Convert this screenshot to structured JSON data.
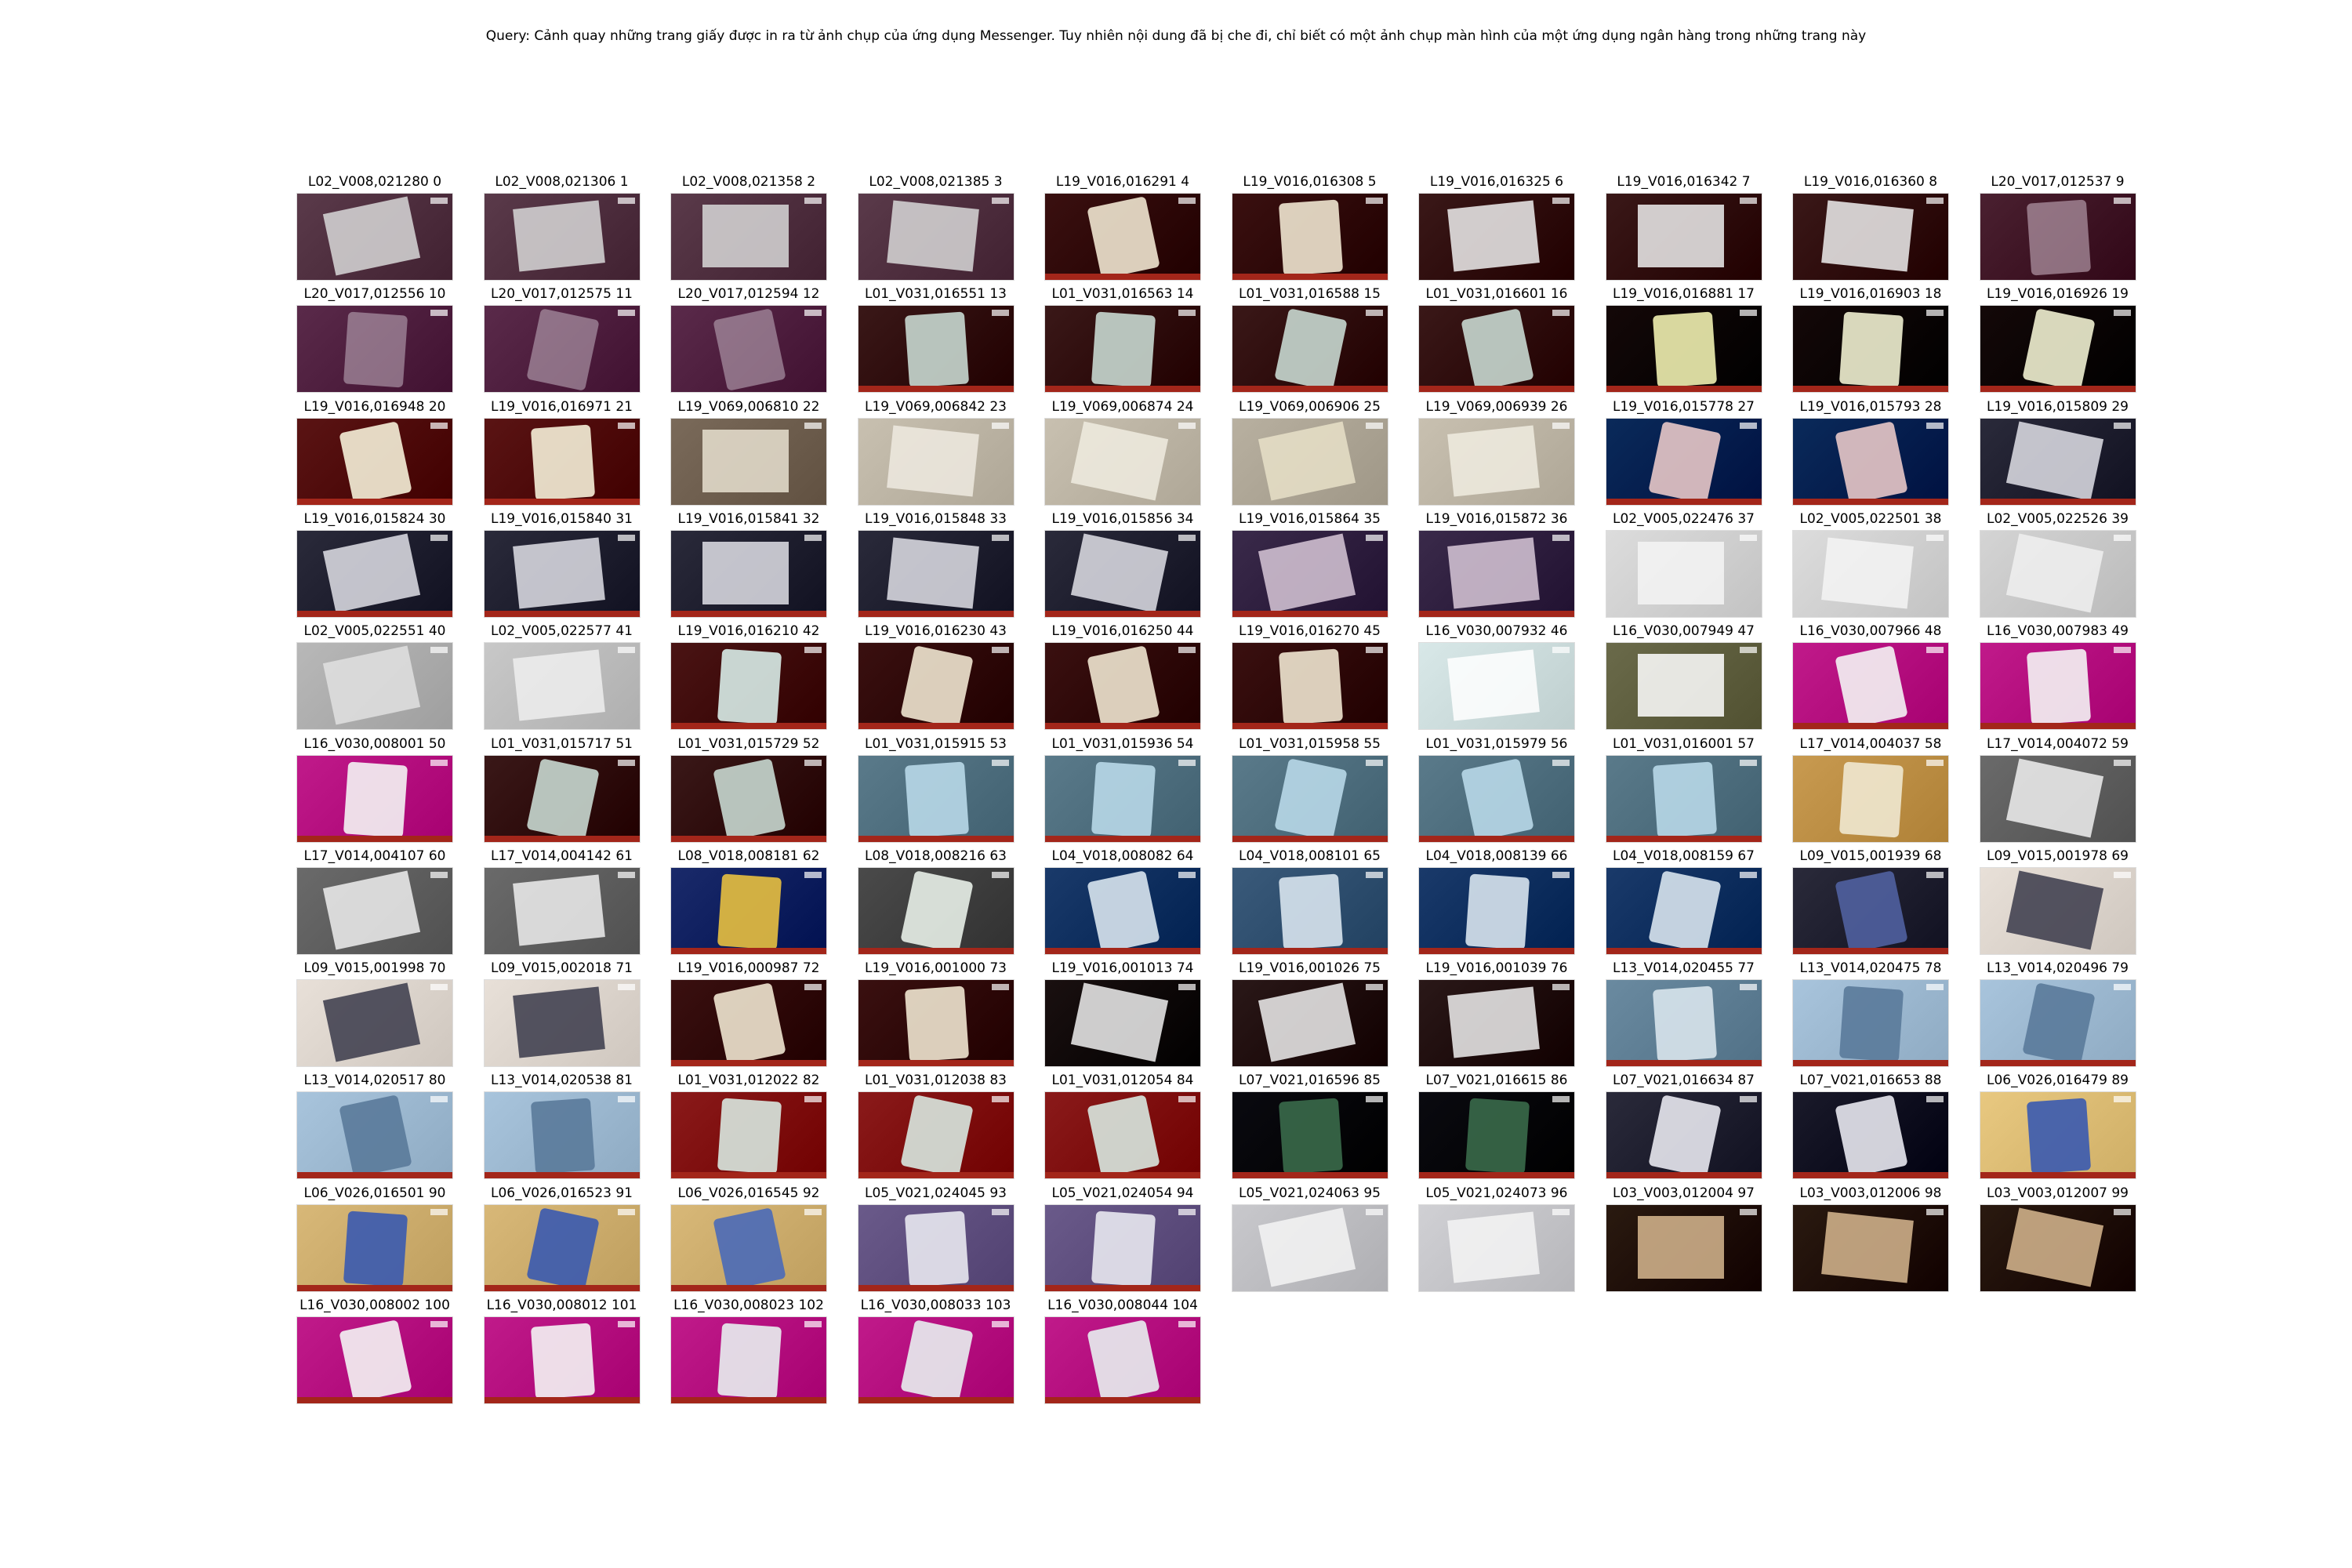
{
  "query": "Query: Cảnh quay những trang giấy được in ra từ ảnh chụp của ứng dụng Messenger. Tuy nhiên nội dung đã bị che đi, chỉ biết có một ảnh chụp màn hình của một ứng dụng ngân hàng trong những trang này",
  "frames": [
    {
      "label": "L02_V008,021280 0",
      "scene": "paper",
      "bg": "#5a3a4a",
      "accent": "#d8d8d8"
    },
    {
      "label": "L02_V008,021306 1",
      "scene": "paper",
      "bg": "#5a3a4a",
      "accent": "#d8d8d8"
    },
    {
      "label": "L02_V008,021358 2",
      "scene": "paper",
      "bg": "#5a3a4a",
      "accent": "#d8d8d8"
    },
    {
      "label": "L02_V008,021385 3",
      "scene": "paper",
      "bg": "#5a3a4a",
      "accent": "#d8d8d8"
    },
    {
      "label": "L19_V016,016291 4",
      "scene": "phone-red",
      "bg": "#3a1010",
      "accent": "#f0e6d0"
    },
    {
      "label": "L19_V016,016308 5",
      "scene": "phone-red",
      "bg": "#3a1010",
      "accent": "#f0e6d0"
    },
    {
      "label": "L19_V016,016325 6",
      "scene": "paper",
      "bg": "#3a1818",
      "accent": "#eeeeee"
    },
    {
      "label": "L19_V016,016342 7",
      "scene": "paper",
      "bg": "#3a1818",
      "accent": "#eeeeee"
    },
    {
      "label": "L19_V016,016360 8",
      "scene": "paper",
      "bg": "#3a1818",
      "accent": "#eeeeee"
    },
    {
      "label": "L20_V017,012537 9",
      "scene": "blur",
      "bg": "#4a2030",
      "accent": "#c8b0c0"
    },
    {
      "label": "L20_V017,012556 10",
      "scene": "blur",
      "bg": "#5a2a4a",
      "accent": "#bba8b8"
    },
    {
      "label": "L20_V017,012575 11",
      "scene": "blur",
      "bg": "#5a2a4a",
      "accent": "#bba8b8"
    },
    {
      "label": "L20_V017,012594 12",
      "scene": "blur",
      "bg": "#5a2a4a",
      "accent": "#bba8b8"
    },
    {
      "label": "L01_V031,016551 13",
      "scene": "phone-red",
      "bg": "#3a1818",
      "accent": "#c8d8d0"
    },
    {
      "label": "L01_V031,016563 14",
      "scene": "phone-red",
      "bg": "#3a1818",
      "accent": "#c8d8d0"
    },
    {
      "label": "L01_V031,016588 15",
      "scene": "phone-red",
      "bg": "#3a1818",
      "accent": "#c8d8d0"
    },
    {
      "label": "L01_V031,016601 16",
      "scene": "phone-red",
      "bg": "#3a1818",
      "accent": "#c8d8d0"
    },
    {
      "label": "L19_V016,016881 17",
      "scene": "phone-dark",
      "bg": "#140808",
      "accent": "#f0f0b0"
    },
    {
      "label": "L19_V016,016903 18",
      "scene": "phone-dark",
      "bg": "#140808",
      "accent": "#f0f0d0"
    },
    {
      "label": "L19_V016,016926 19",
      "scene": "phone-dark",
      "bg": "#140808",
      "accent": "#f0f0d0"
    },
    {
      "label": "L19_V016,016948 20",
      "scene": "phone-dark",
      "bg": "#5a1414",
      "accent": "#f5f0d8"
    },
    {
      "label": "L19_V016,016971 21",
      "scene": "phone-dark",
      "bg": "#5a1414",
      "accent": "#f5f0d8"
    },
    {
      "label": "L19_V069,006810 22",
      "scene": "hand",
      "bg": "#7a6a5a",
      "accent": "#e8e0d0"
    },
    {
      "label": "L19_V069,006842 23",
      "scene": "hand",
      "bg": "#c8c0b0",
      "accent": "#eeeae0"
    },
    {
      "label": "L19_V069,006874 24",
      "scene": "hand",
      "bg": "#c8c0b0",
      "accent": "#f0ece0"
    },
    {
      "label": "L19_V069,006906 25",
      "scene": "hand",
      "bg": "#b8b0a0",
      "accent": "#e8e0c8"
    },
    {
      "label": "L19_V069,006939 26",
      "scene": "hand",
      "bg": "#c8c0b0",
      "accent": "#f0ece0"
    },
    {
      "label": "L19_V016,015778 27",
      "scene": "studio",
      "bg": "#0a2a5a",
      "accent": "#e8c8c8"
    },
    {
      "label": "L19_V016,015793 28",
      "scene": "studio",
      "bg": "#0a2a5a",
      "accent": "#e8c8c8"
    },
    {
      "label": "L19_V016,015809 29",
      "scene": "text",
      "bg": "#2a2a3a",
      "accent": "#e0e0e8"
    },
    {
      "label": "L19_V016,015824 30",
      "scene": "text",
      "bg": "#2a2a3a",
      "accent": "#e0e0e8"
    },
    {
      "label": "L19_V016,015840 31",
      "scene": "text",
      "bg": "#2a2a3a",
      "accent": "#e0e0e8"
    },
    {
      "label": "L19_V016,015841 32",
      "scene": "text",
      "bg": "#2a2a3a",
      "accent": "#e0e0e8"
    },
    {
      "label": "L19_V016,015848 33",
      "scene": "text",
      "bg": "#2a2a3a",
      "accent": "#e0e0e8"
    },
    {
      "label": "L19_V016,015856 34",
      "scene": "text",
      "bg": "#2a2a3a",
      "accent": "#e0e0e8"
    },
    {
      "label": "L19_V016,015864 35",
      "scene": "news",
      "bg": "#3a2a4a",
      "accent": "#d8c8d8"
    },
    {
      "label": "L19_V016,015872 36",
      "scene": "news",
      "bg": "#3a2a4a",
      "accent": "#d8c8d8"
    },
    {
      "label": "L02_V005,022476 37",
      "scene": "doc",
      "bg": "#dcdcdc",
      "accent": "#f4f4f4"
    },
    {
      "label": "L02_V005,022501 38",
      "scene": "doc",
      "bg": "#dcdcdc",
      "accent": "#f4f4f4"
    },
    {
      "label": "L02_V005,022526 39",
      "scene": "doc",
      "bg": "#d4d4d4",
      "accent": "#f0f0f0"
    },
    {
      "label": "L02_V005,022551 40",
      "scene": "doc",
      "bg": "#b8b8b8",
      "accent": "#e0e0e0"
    },
    {
      "label": "L02_V005,022577 41",
      "scene": "doc",
      "bg": "#c8c8c8",
      "accent": "#eeeeee"
    },
    {
      "label": "L19_V016,016210 42",
      "scene": "phone-red",
      "bg": "#4a1414",
      "accent": "#d8ece8"
    },
    {
      "label": "L19_V016,016230 43",
      "scene": "phone-red",
      "bg": "#3a1010",
      "accent": "#f0e6d0"
    },
    {
      "label": "L19_V016,016250 44",
      "scene": "phone-red",
      "bg": "#3a1010",
      "accent": "#f0e6d0"
    },
    {
      "label": "L19_V016,016270 45",
      "scene": "phone-red",
      "bg": "#3a1010",
      "accent": "#f0e6d0"
    },
    {
      "label": "L16_V030,007932 46",
      "scene": "doc",
      "bg": "#d8e8e8",
      "accent": "#ffffff"
    },
    {
      "label": "L16_V030,007949 47",
      "scene": "doc",
      "bg": "#6a6a4a",
      "accent": "#ffffff"
    },
    {
      "label": "L16_V030,007966 48",
      "scene": "magenta",
      "bg": "#c01a8a",
      "accent": "#f4f4f4"
    },
    {
      "label": "L16_V030,007983 49",
      "scene": "magenta",
      "bg": "#c01a8a",
      "accent": "#f4f4f4"
    },
    {
      "label": "L16_V030,008001 50",
      "scene": "magenta",
      "bg": "#c01a8a",
      "accent": "#f4f4f4"
    },
    {
      "label": "L01_V031,015717 51",
      "scene": "phone-red",
      "bg": "#3a1818",
      "accent": "#c8d8d0"
    },
    {
      "label": "L01_V031,015729 52",
      "scene": "phone-red",
      "bg": "#3a1818",
      "accent": "#c8d8d0"
    },
    {
      "label": "L01_V031,015915 53",
      "scene": "blurblue",
      "bg": "#5a7a8a",
      "accent": "#b8d8e8"
    },
    {
      "label": "L01_V031,015936 54",
      "scene": "blurblue",
      "bg": "#5a7a8a",
      "accent": "#b8d8e8"
    },
    {
      "label": "L01_V031,015958 55",
      "scene": "blurblue",
      "bg": "#5a7a8a",
      "accent": "#b8d8e8"
    },
    {
      "label": "L01_V031,015979 56",
      "scene": "blurblue",
      "bg": "#5a7a8a",
      "accent": "#b8d8e8"
    },
    {
      "label": "L01_V031,016001 57",
      "scene": "blurblue",
      "bg": "#5a7a8a",
      "accent": "#b8d8e8"
    },
    {
      "label": "L17_V014,004037 58",
      "scene": "room",
      "bg": "#c89a50",
      "accent": "#f0e8d0"
    },
    {
      "label": "L17_V014,004072 59",
      "scene": "screen",
      "bg": "#6a6a6a",
      "accent": "#f0f0f0"
    },
    {
      "label": "L17_V014,004107 60",
      "scene": "screen",
      "bg": "#6a6a6a",
      "accent": "#eeeeee"
    },
    {
      "label": "L17_V014,004142 61",
      "scene": "screen",
      "bg": "#6a6a6a",
      "accent": "#eeeeee"
    },
    {
      "label": "L08_V018,008181 62",
      "scene": "ad",
      "bg": "#1a2a6a",
      "accent": "#e8c040"
    },
    {
      "label": "L08_V018,008216 63",
      "scene": "phone-dark",
      "bg": "#4a4a4a",
      "accent": "#e8f0e8"
    },
    {
      "label": "L04_V018,008082 64",
      "scene": "bluephone",
      "bg": "#1a3a6a",
      "accent": "#d8e4ee"
    },
    {
      "label": "L04_V018,008101 65",
      "scene": "bluephone",
      "bg": "#3a5a7a",
      "accent": "#d8e4ee"
    },
    {
      "label": "L04_V018,008139 66",
      "scene": "bluephone",
      "bg": "#1a3a6a",
      "accent": "#d8e4ee"
    },
    {
      "label": "L04_V018,008159 67",
      "scene": "bluephone",
      "bg": "#1a3a6a",
      "accent": "#d8e4ee"
    },
    {
      "label": "L09_V015,001939 68",
      "scene": "phone-dark",
      "bg": "#2a2a3a",
      "accent": "#5060a0"
    },
    {
      "label": "L09_V015,001978 69",
      "scene": "hand",
      "bg": "#e8e0d8",
      "accent": "#3a3a4a"
    },
    {
      "label": "L09_V015,001998 70",
      "scene": "hand",
      "bg": "#e8e0d8",
      "accent": "#3a3a4a"
    },
    {
      "label": "L09_V015,002018 71",
      "scene": "hand",
      "bg": "#e8e0d8",
      "accent": "#3a3a4a"
    },
    {
      "label": "L19_V016,000987 72",
      "scene": "phone-red",
      "bg": "#3a1010",
      "accent": "#f0e6d0"
    },
    {
      "label": "L19_V016,001000 73",
      "scene": "phone-red",
      "bg": "#3a1010",
      "accent": "#f0e6d0"
    },
    {
      "label": "L19_V016,001013 74",
      "scene": "paper",
      "bg": "#1a1010",
      "accent": "#f0f0f0"
    },
    {
      "label": "L19_V016,001026 75",
      "scene": "paper",
      "bg": "#2a1818",
      "accent": "#f0f0f0"
    },
    {
      "label": "L19_V016,001039 76",
      "scene": "paper",
      "bg": "#2a1818",
      "accent": "#f0f0f0"
    },
    {
      "label": "L13_V014,020455 77",
      "scene": "desk",
      "bg": "#6a8aa0",
      "accent": "#d8e4ec"
    },
    {
      "label": "L13_V014,020475 78",
      "scene": "desk",
      "bg": "#a8c4dc",
      "accent": "#5a7a9a"
    },
    {
      "label": "L13_V014,020496 79",
      "scene": "desk",
      "bg": "#a8c4dc",
      "accent": "#5a7a9a"
    },
    {
      "label": "L13_V014,020517 80",
      "scene": "desk",
      "bg": "#a8c4dc",
      "accent": "#5a7a9a"
    },
    {
      "label": "L13_V014,020538 81",
      "scene": "desk",
      "bg": "#a8c4dc",
      "accent": "#5a7a9a"
    },
    {
      "label": "L01_V031,012022 82",
      "scene": "phone-red",
      "bg": "#8a1a1a",
      "accent": "#d8e8e0"
    },
    {
      "label": "L01_V031,012038 83",
      "scene": "phone-red",
      "bg": "#8a1a1a",
      "accent": "#d8e8e0"
    },
    {
      "label": "L01_V031,012054 84",
      "scene": "phone-red",
      "bg": "#8a1a1a",
      "accent": "#d8e8e0"
    },
    {
      "label": "L07_V021,016596 85",
      "scene": "phone-dark",
      "bg": "#0a0a10",
      "accent": "#3a6a4a"
    },
    {
      "label": "L07_V021,016615 86",
      "scene": "phone-dark",
      "bg": "#0a0a10",
      "accent": "#3a6a4a"
    },
    {
      "label": "L07_V021,016634 87",
      "scene": "fb",
      "bg": "#2a2a3a",
      "accent": "#e8e8f0"
    },
    {
      "label": "L07_V021,016653 88",
      "scene": "fb",
      "bg": "#1a1a2a",
      "accent": "#e8e8f0"
    },
    {
      "label": "L06_V026,016479 89",
      "scene": "bluephone",
      "bg": "#e8c880",
      "accent": "#3a5ab0"
    },
    {
      "label": "L06_V026,016501 90",
      "scene": "bluephone",
      "bg": "#d8b878",
      "accent": "#3a5ab0"
    },
    {
      "label": "L06_V026,016523 91",
      "scene": "bluephone",
      "bg": "#d8b878",
      "accent": "#3a5ab0"
    },
    {
      "label": "L06_V026,016545 92",
      "scene": "bluephone",
      "bg": "#d8b878",
      "accent": "#4a6ab8"
    },
    {
      "label": "L05_V021,024045 93",
      "scene": "fb",
      "bg": "#6a5a8a",
      "accent": "#e8e8f0"
    },
    {
      "label": "L05_V021,024054 94",
      "scene": "fb",
      "bg": "#6a5a8a",
      "accent": "#e8e8f0"
    },
    {
      "label": "L05_V021,024063 95",
      "scene": "doc",
      "bg": "#c8c8cc",
      "accent": "#f4f4f4"
    },
    {
      "label": "L05_V021,024073 96",
      "scene": "doc",
      "bg": "#d0d0d4",
      "accent": "#f4f4f4"
    },
    {
      "label": "L03_V003,012004 97",
      "scene": "book",
      "bg": "#2a1a10",
      "accent": "#d8b890"
    },
    {
      "label": "L03_V003,012006 98",
      "scene": "book",
      "bg": "#2a1a10",
      "accent": "#d8b890"
    },
    {
      "label": "L03_V003,012007 99",
      "scene": "book",
      "bg": "#2a1a10",
      "accent": "#d8b890"
    },
    {
      "label": "L16_V030,008002 100",
      "scene": "magenta",
      "bg": "#c01a8a",
      "accent": "#f4f4f4"
    },
    {
      "label": "L16_V030,008012 101",
      "scene": "magenta",
      "bg": "#c01a8a",
      "accent": "#f4f4f4"
    },
    {
      "label": "L16_V030,008023 102",
      "scene": "magenta",
      "bg": "#c01a8a",
      "accent": "#e8f0f0"
    },
    {
      "label": "L16_V030,008033 103",
      "scene": "magenta",
      "bg": "#c01a8a",
      "accent": "#e8f0f0"
    },
    {
      "label": "L16_V030,008044 104",
      "scene": "magenta",
      "bg": "#c01a8a",
      "accent": "#e8f0f0"
    }
  ]
}
